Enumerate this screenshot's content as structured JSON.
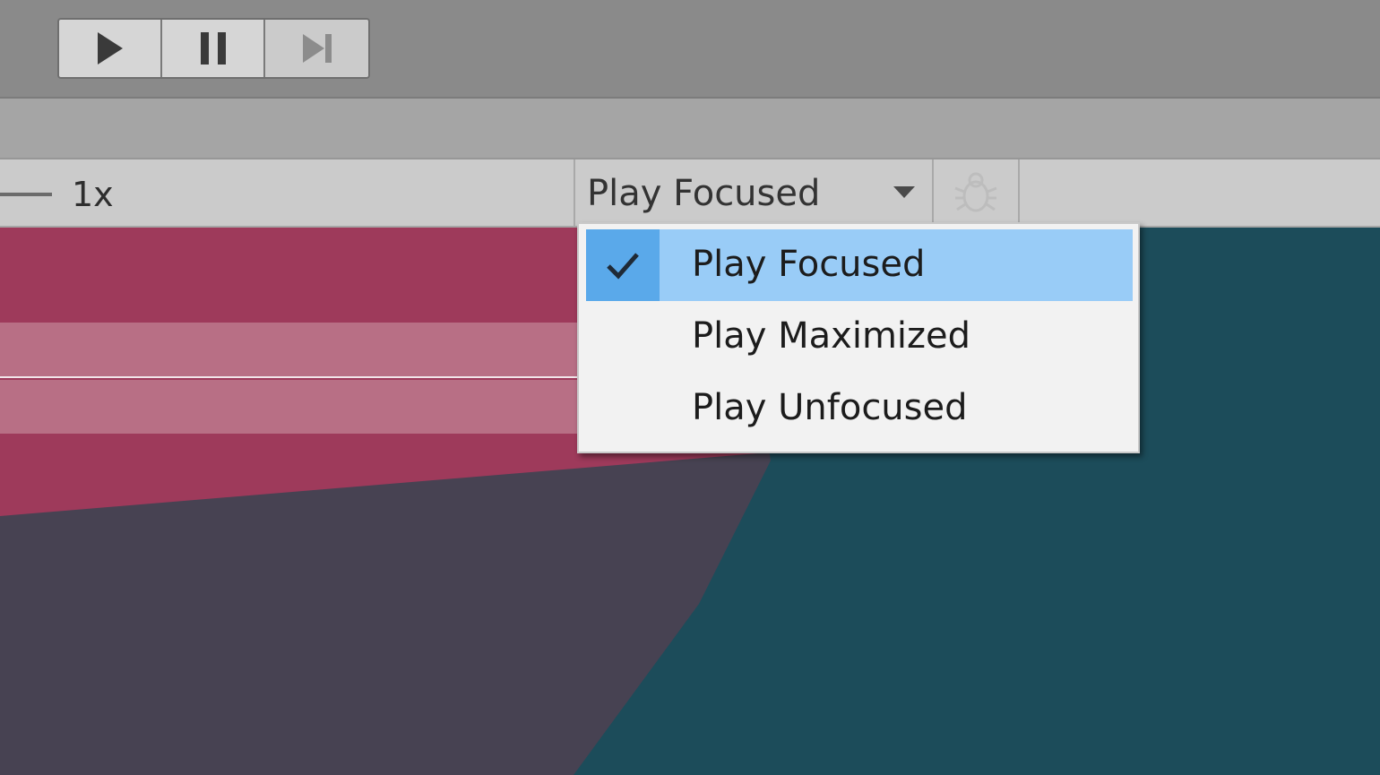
{
  "toolbar": {
    "play_icon": "play-icon",
    "pause_icon": "pause-icon",
    "step_icon": "step-icon"
  },
  "game_view": {
    "scale_label": "1x",
    "play_mode": {
      "selected_label": "Play Focused",
      "caret_icon": "chevron-down-icon"
    },
    "debug_icon": "bug-icon"
  },
  "menu": {
    "items": [
      {
        "label": "Play Focused",
        "checked": true
      },
      {
        "label": "Play Maximized",
        "checked": false
      },
      {
        "label": "Play Unfocused",
        "checked": false
      }
    ],
    "check_icon": "checkmark-icon"
  },
  "colors": {
    "selection_highlight": "#99ccf7",
    "check_column": "#5aa9ea",
    "scene_red": "#9e3a5b",
    "scene_teal": "#1c4c5a",
    "scene_dark": "#474252"
  }
}
